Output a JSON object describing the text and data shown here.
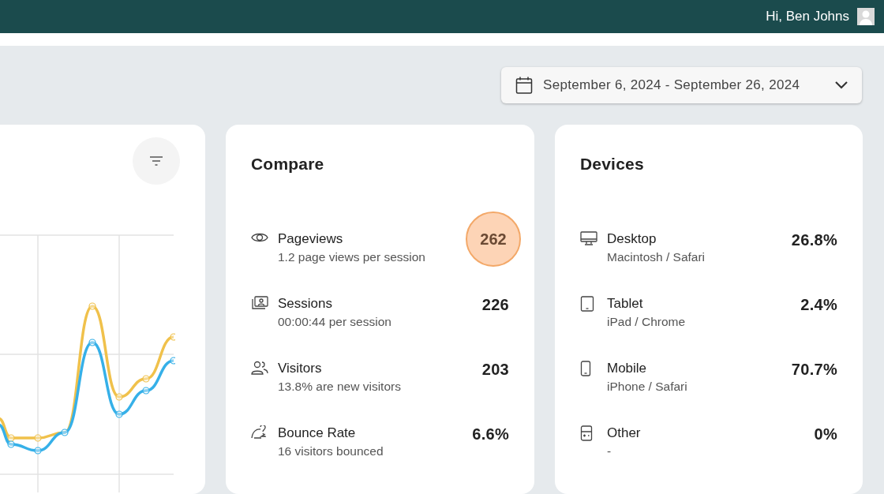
{
  "header": {
    "greeting": "Hi, Ben Johns"
  },
  "date_range": {
    "label": "September 6, 2024 - September 26, 2024"
  },
  "compare": {
    "title": "Compare",
    "metrics": [
      {
        "kind": "pageviews",
        "label": "Pageviews",
        "detail": "1.2 page views per session",
        "value": "262",
        "highlighted": true
      },
      {
        "kind": "sessions",
        "label": "Sessions",
        "detail": "00:00:44 per session",
        "value": "226",
        "highlighted": false
      },
      {
        "kind": "visitors",
        "label": "Visitors",
        "detail": "13.8% are new visitors",
        "value": "203",
        "highlighted": false
      },
      {
        "kind": "bounce",
        "label": "Bounce Rate",
        "detail": "16 visitors bounced",
        "value": "6.6%",
        "highlighted": false
      }
    ]
  },
  "devices": {
    "title": "Devices",
    "items": [
      {
        "kind": "desktop",
        "label": "Desktop",
        "detail": "Macintosh / Safari",
        "value": "26.8%"
      },
      {
        "kind": "tablet",
        "label": "Tablet",
        "detail": "iPad / Chrome",
        "value": "2.4%"
      },
      {
        "kind": "mobile",
        "label": "Mobile",
        "detail": "iPhone / Safari",
        "value": "70.7%"
      },
      {
        "kind": "other",
        "label": "Other",
        "detail": "-",
        "value": "0%"
      }
    ]
  }
}
